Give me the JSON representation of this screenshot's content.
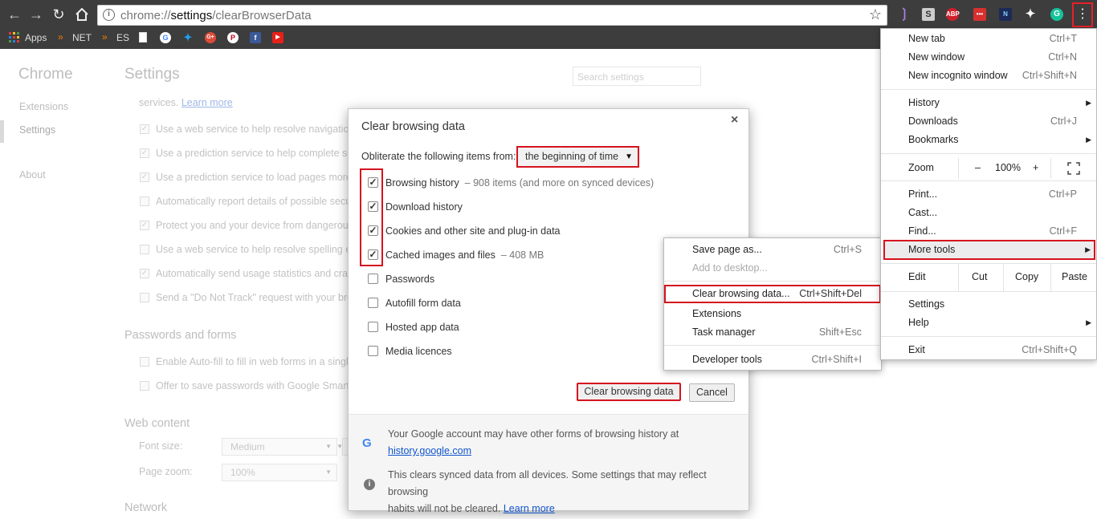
{
  "browser": {
    "url_scheme": "chrome://",
    "url_host": "settings",
    "url_path": "/clearBrowserData",
    "bookmarks": [
      {
        "icon": "apps-grid-icon",
        "label": "Apps"
      },
      {
        "icon": "bookmark-folder-icon",
        "label": "NET"
      },
      {
        "icon": "bookmark-folder-icon",
        "label": "ES"
      }
    ]
  },
  "settings_bg": {
    "sidebar_title": "Chrome",
    "sidebar_items": [
      "Extensions",
      "Settings",
      "About"
    ],
    "page_title": "Settings",
    "search_placeholder": "Search settings",
    "intro_tail": "services.",
    "intro_link": "Learn more",
    "privacy_rows": [
      "Use a web service to help resolve navigation e",
      "Use a prediction service to help complete sea",
      "Use a prediction service to load pages more c",
      "Automatically report details of possible secur",
      "Protect you and your device from dangerous",
      "Use a web service to help resolve spelling err",
      "Automatically send usage statistics and crash",
      "Send a \"Do Not Track\" request with your brov"
    ],
    "passwords_heading": "Passwords and forms",
    "password_rows": [
      "Enable Auto-fill to fill in web forms in a single",
      "Offer to save passwords with Google Smart L"
    ],
    "web_content_heading": "Web content",
    "font_size_label": "Font size:",
    "font_size_value": "Medium",
    "page_zoom_label": "Page zoom:",
    "page_zoom_value": "100%",
    "network_heading": "Network"
  },
  "dialog": {
    "title": "Clear browsing data",
    "close": "×",
    "obliterate_label": "Obliterate the following items from:",
    "time_range": "the beginning of time",
    "items": [
      {
        "label": "Browsing history",
        "detail": "–  908 items (and more on synced devices)",
        "checked": true
      },
      {
        "label": "Download history",
        "detail": "",
        "checked": true
      },
      {
        "label": "Cookies and other site and plug-in data",
        "detail": "",
        "checked": true
      },
      {
        "label": "Cached images and files",
        "detail": "–  408 MB",
        "checked": true
      },
      {
        "label": "Passwords",
        "detail": "",
        "checked": false
      },
      {
        "label": "Autofill form data",
        "detail": "",
        "checked": false
      },
      {
        "label": "Hosted app data",
        "detail": "",
        "checked": false
      },
      {
        "label": "Media licences",
        "detail": "",
        "checked": false
      }
    ],
    "clear_button": "Clear browsing data",
    "cancel_button": "Cancel",
    "footer_line1": "Your Google account may have other forms of browsing history at",
    "footer_link1": "history.google.com",
    "footer_line2a": "This clears synced data from all devices. Some settings that may reflect browsing",
    "footer_line2b": "habits will not be cleared.",
    "footer_link2": "Learn more"
  },
  "chrome_menu": {
    "new_tab": "New tab",
    "new_tab_sc": "Ctrl+T",
    "new_window": "New window",
    "new_window_sc": "Ctrl+N",
    "new_incognito": "New incognito window",
    "new_incognito_sc": "Ctrl+Shift+N",
    "history": "History",
    "downloads": "Downloads",
    "downloads_sc": "Ctrl+J",
    "bookmarks": "Bookmarks",
    "zoom": "Zoom",
    "zoom_minus": "–",
    "zoom_level": "100%",
    "zoom_plus": "+",
    "print": "Print...",
    "print_sc": "Ctrl+P",
    "cast": "Cast...",
    "find": "Find...",
    "find_sc": "Ctrl+F",
    "more_tools": "More tools",
    "edit": "Edit",
    "cut": "Cut",
    "copy": "Copy",
    "paste": "Paste",
    "settings": "Settings",
    "help": "Help",
    "exit": "Exit",
    "exit_sc": "Ctrl+Shift+Q"
  },
  "more_tools_menu": {
    "save_page": "Save page as...",
    "save_page_sc": "Ctrl+S",
    "add_desktop": "Add to desktop...",
    "clear_data": "Clear browsing data...",
    "clear_data_sc": "Ctrl+Shift+Del",
    "extensions": "Extensions",
    "task_manager": "Task manager",
    "task_manager_sc": "Shift+Esc",
    "dev_tools": "Developer tools",
    "dev_tools_sc": "Ctrl+Shift+I"
  },
  "colors": {
    "highlight_red": "#d5131f",
    "link_blue": "#1155cc",
    "toolbar_dark": "#3d3d3d"
  }
}
